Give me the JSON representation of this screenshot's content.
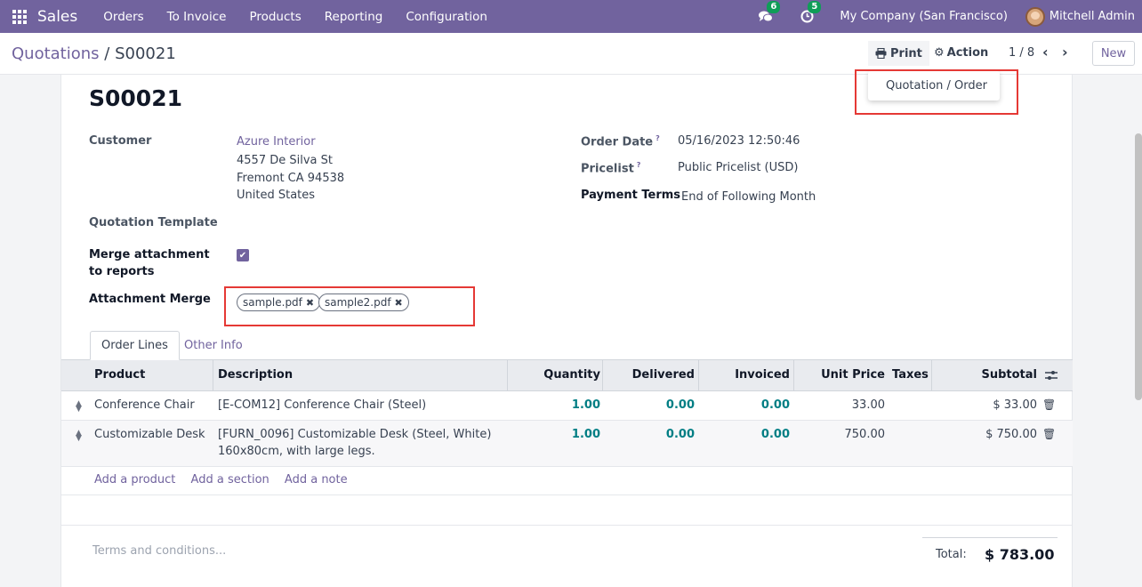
{
  "navbar": {
    "brand": "Sales",
    "menu": [
      "Orders",
      "To Invoice",
      "Products",
      "Reporting",
      "Configuration"
    ],
    "messages_badge": "6",
    "activities_badge": "5",
    "company": "My Company (San Francisco)",
    "user": "Mitchell Admin",
    "color": "#71639e"
  },
  "control": {
    "breadcrumb_parent": "Quotations",
    "breadcrumb_sep": "/",
    "breadcrumb_current": "S00021",
    "print_label": "Print",
    "action_label": "Action",
    "pager": "1 / 8",
    "new_label": "New",
    "print_menu_item": "Quotation / Order"
  },
  "form": {
    "order_name": "S00021",
    "customer_label": "Customer",
    "customer_name": "Azure Interior",
    "customer_street": "4557 De Silva St",
    "customer_city": "Fremont CA 94538",
    "customer_country": "United States",
    "template_label": "Quotation Template",
    "merge_label": "Merge attachment to reports",
    "merge_checked": true,
    "attachment_label": "Attachment Merge",
    "attachments": [
      "sample.pdf",
      "sample2.pdf"
    ],
    "order_date_label": "Order Date",
    "order_date": "05/16/2023 12:50:46",
    "pricelist_label": "Pricelist",
    "pricelist": "Public Pricelist (USD)",
    "payment_terms_label": "Payment Terms",
    "payment_terms": "End of Following Month",
    "help_mark": "?"
  },
  "tabs": [
    "Order Lines",
    "Other Info"
  ],
  "table": {
    "headers": [
      "Product",
      "Description",
      "Quantity",
      "Delivered",
      "Invoiced",
      "Unit Price",
      "Taxes",
      "Subtotal"
    ],
    "rows": [
      {
        "product": "Conference Chair",
        "description": "[E-COM12] Conference Chair (Steel)",
        "description2": "",
        "quantity": "1.00",
        "delivered": "0.00",
        "invoiced": "0.00",
        "unit_price": "33.00",
        "taxes": "",
        "subtotal": "$ 33.00"
      },
      {
        "product": "Customizable Desk",
        "description": "[FURN_0096] Customizable Desk (Steel, White)",
        "description2": "160x80cm, with large legs.",
        "quantity": "1.00",
        "delivered": "0.00",
        "invoiced": "0.00",
        "unit_price": "750.00",
        "taxes": "",
        "subtotal": "$ 750.00"
      }
    ],
    "add_links": [
      "Add a product",
      "Add a section",
      "Add a note"
    ]
  },
  "footer": {
    "terms_placeholder": "Terms and conditions...",
    "total_label": "Total:",
    "total_value": "$ 783.00"
  }
}
